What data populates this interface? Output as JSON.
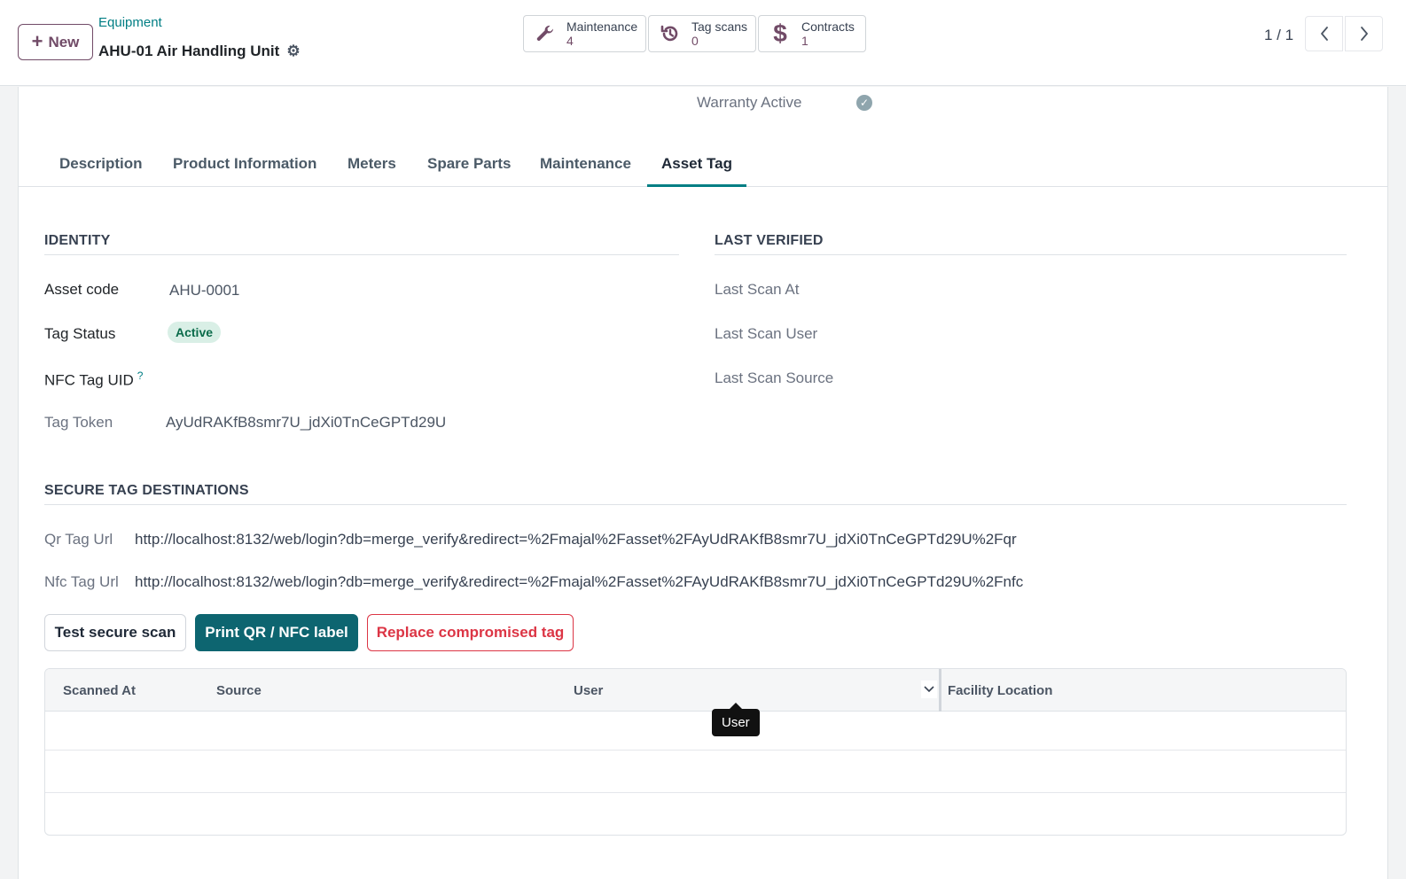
{
  "header": {
    "new_label": "New",
    "breadcrumb_parent": "Equipment",
    "record_title": "AHU-01 Air Handling Unit",
    "smart_buttons": [
      {
        "label": "Maintenance",
        "value": "4",
        "icon": "wrench-icon"
      },
      {
        "label": "Tag scans",
        "value": "0",
        "icon": "history-icon"
      },
      {
        "label": "Contracts",
        "value": "1",
        "icon": "dollar-icon"
      }
    ],
    "pager": "1 / 1"
  },
  "form": {
    "warranty_label": "Warranty Active",
    "warranty_active": true,
    "tabs": [
      {
        "label": "Description"
      },
      {
        "label": "Product Information"
      },
      {
        "label": "Meters"
      },
      {
        "label": "Spare Parts"
      },
      {
        "label": "Maintenance"
      },
      {
        "label": "Asset Tag",
        "active": true
      }
    ],
    "identity": {
      "title": "IDENTITY",
      "asset_code_label": "Asset code",
      "asset_code": "AHU-0001",
      "tag_status_label": "Tag Status",
      "tag_status": "Active",
      "nfc_uid_label": "NFC Tag UID",
      "nfc_uid_help": "?",
      "tag_token_label": "Tag Token",
      "tag_token": "AyUdRAKfB8smr7U_jdXi0TnCeGPTd29U"
    },
    "last_verified": {
      "title": "LAST VERIFIED",
      "last_scan_at_label": "Last Scan At",
      "last_scan_user_label": "Last Scan User",
      "last_scan_source_label": "Last Scan Source"
    },
    "destinations": {
      "title": "SECURE TAG DESTINATIONS",
      "qr_label": "Qr Tag Url",
      "qr_url": "http://localhost:8132/web/login?db=merge_verify&redirect=%2Fmajal%2Fasset%2FAyUdRAKfB8smr7U_jdXi0TnCeGPTd29U%2Fqr",
      "nfc_label": "Nfc Tag Url",
      "nfc_url": "http://localhost:8132/web/login?db=merge_verify&redirect=%2Fmajal%2Fasset%2FAyUdRAKfB8smr7U_jdXi0TnCeGPTd29U%2Fnfc"
    },
    "actions": {
      "test_scan": "Test secure scan",
      "print_label": "Print QR / NFC label",
      "replace_tag": "Replace compromised tag"
    },
    "scan_table": {
      "columns": [
        "Scanned At",
        "Source",
        "User",
        "Facility Location"
      ],
      "rows": []
    },
    "tooltip": "User"
  },
  "colors": {
    "brand": "#714b67",
    "primary": "#0d6570",
    "danger": "#dc3545",
    "link": "#017e84"
  }
}
